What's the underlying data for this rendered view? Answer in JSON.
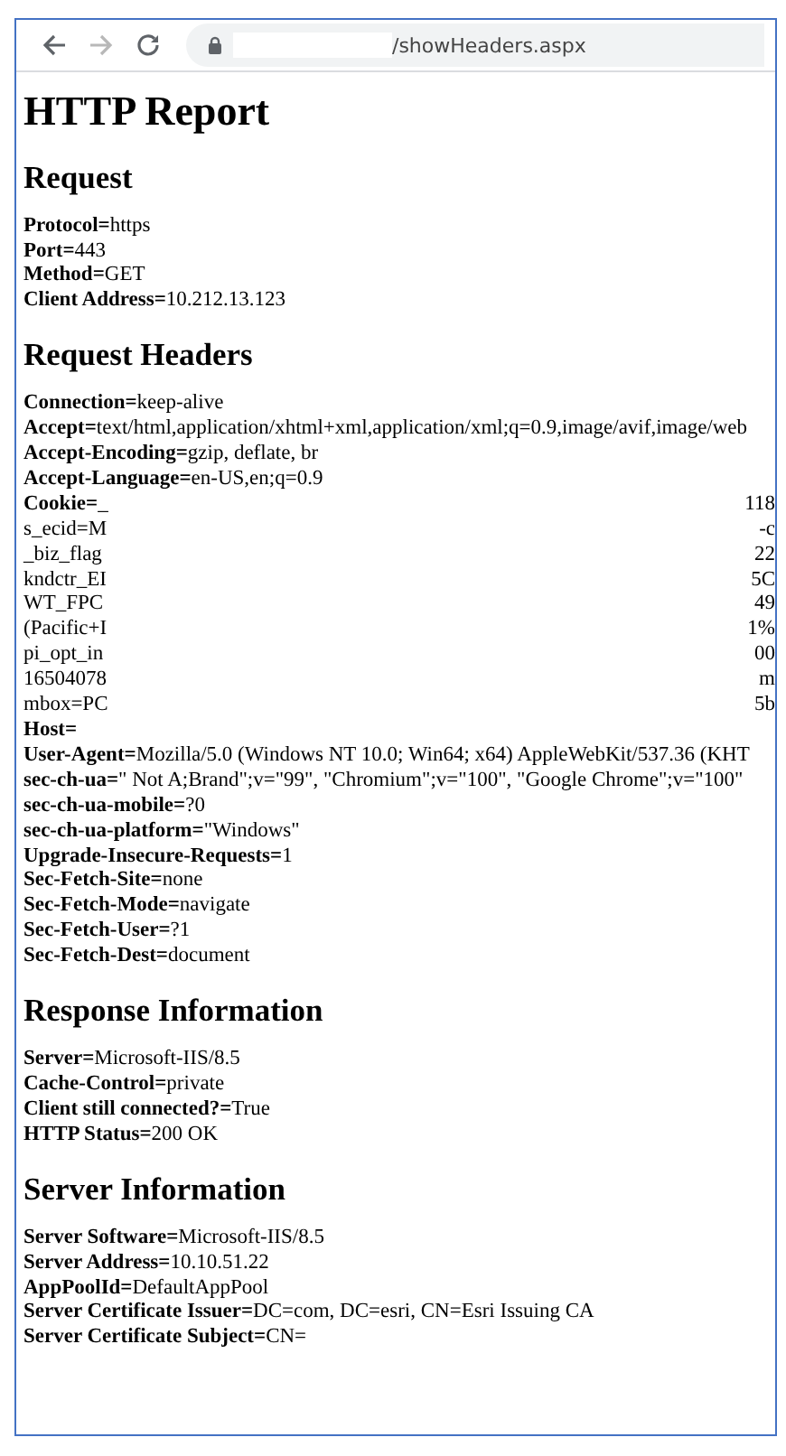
{
  "browser": {
    "url": "/showHeaders.aspx",
    "buttons": [
      {
        "kind": "back",
        "disabled": false
      },
      {
        "kind": "forward",
        "disabled": true
      },
      {
        "kind": "reload",
        "disabled": false
      }
    ]
  },
  "title": "HTTP Report",
  "sections": [
    {
      "heading": "Request",
      "lines": [
        {
          "key": "Protocol=",
          "value": "https"
        },
        {
          "key": "Port=",
          "value": "443"
        },
        {
          "key": "Method=",
          "value": "GET"
        },
        {
          "key": "Client Address=",
          "value": "10.212.13.123"
        }
      ]
    },
    {
      "heading": "Request Headers",
      "lines": [
        {
          "key": "Connection=",
          "value": "keep-alive"
        },
        {
          "key": "Accept=",
          "value": "text/html,application/xhtml+xml,application/xml;q=0.9,image/avif,image/web"
        },
        {
          "key": "Accept-Encoding=",
          "value": "gzip, deflate, br"
        },
        {
          "key": "Accept-Language=",
          "value": "en-US,en;q=0.9"
        },
        {
          "key": "Cookie=",
          "value": "_",
          "tail": "118"
        },
        {
          "value": "s_ecid=M",
          "tail": "-c"
        },
        {
          "value": "_biz_flag",
          "tail": "22"
        },
        {
          "value": "kndctr_EI",
          "tail": "5C"
        },
        {
          "value": "WT_FPC",
          "tail": "49"
        },
        {
          "value": "(Pacific+I",
          "tail": "1%"
        },
        {
          "value": "pi_opt_in",
          "tail": "00"
        },
        {
          "value": "16504078",
          "tail": "m"
        },
        {
          "value": "mbox=PC",
          "tail": "5b"
        },
        {
          "key": "Host="
        },
        {
          "key": "User-Agent=",
          "value": "Mozilla/5.0 (Windows NT 10.0; Win64; x64) AppleWebKit/537.36 (KHT"
        },
        {
          "key": "sec-ch-ua=",
          "value": "\" Not A;Brand\";v=\"99\", \"Chromium\";v=\"100\", \"Google Chrome\";v=\"100\""
        },
        {
          "key": "sec-ch-ua-mobile=",
          "value": "?0"
        },
        {
          "key": "sec-ch-ua-platform=",
          "value": "\"Windows\""
        },
        {
          "key": "Upgrade-Insecure-Requests=",
          "value": "1"
        },
        {
          "key": "Sec-Fetch-Site=",
          "value": "none"
        },
        {
          "key": "Sec-Fetch-Mode=",
          "value": "navigate"
        },
        {
          "key": "Sec-Fetch-User=",
          "value": "?1"
        },
        {
          "key": "Sec-Fetch-Dest=",
          "value": "document"
        }
      ]
    },
    {
      "heading": "Response Information",
      "lines": [
        {
          "key": "Server=",
          "value": "Microsoft-IIS/8.5"
        },
        {
          "key": "Cache-Control=",
          "value": "private"
        },
        {
          "key": "Client still connected?=",
          "value": "True"
        },
        {
          "key": "HTTP Status=",
          "value": "200 OK"
        }
      ]
    },
    {
      "heading": "Server Information",
      "lines": [
        {
          "key": "Server Software=",
          "value": "Microsoft-IIS/8.5"
        },
        {
          "key": "Server Address=",
          "value": "10.10.51.22"
        },
        {
          "key": "AppPoolId=",
          "value": "DefaultAppPool"
        },
        {
          "key": "Server Certificate Issuer=",
          "value": "DC=com, DC=esri, CN=Esri Issuing CA"
        },
        {
          "key": "Server Certificate Subject=",
          "value": "CN="
        }
      ]
    }
  ]
}
